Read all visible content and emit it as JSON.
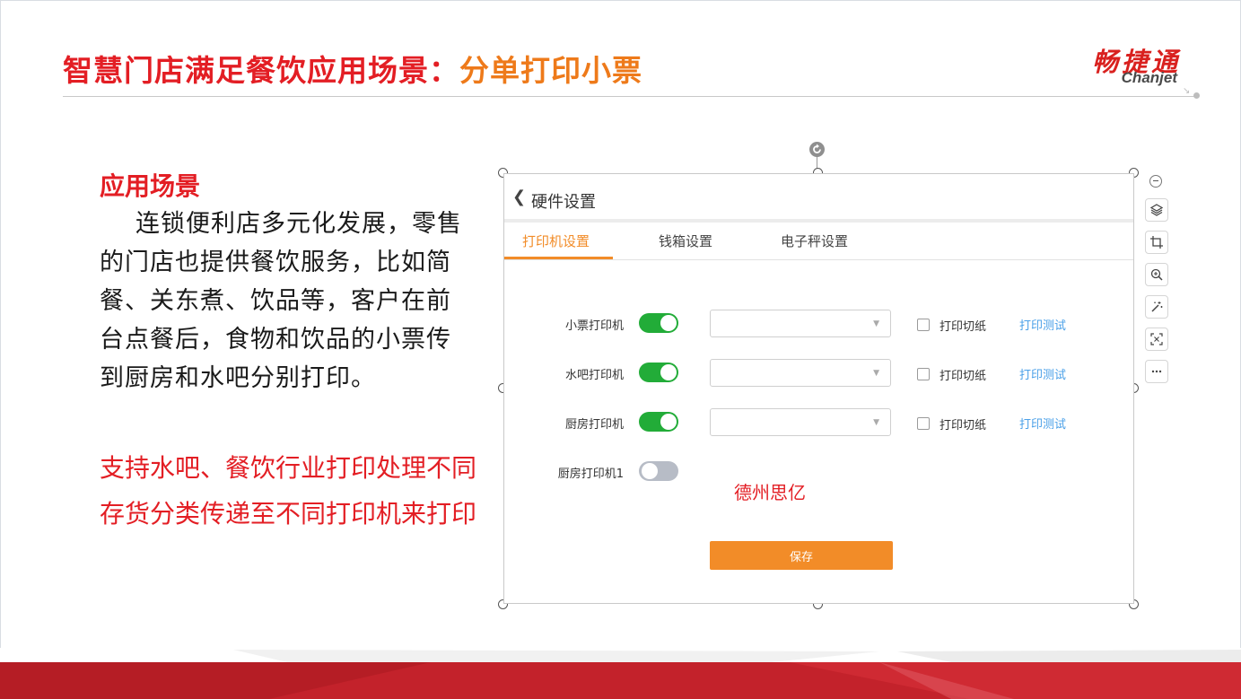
{
  "slide": {
    "title_main": "智慧门店满足餐饮应用场景：",
    "title_highlight": "分单打印小票",
    "logo_cn": "畅捷通",
    "logo_en": "Chanjet"
  },
  "scene": {
    "heading": "应用场景",
    "body": "连锁便利店多元化发展，零售的门店也提供餐饮服务，比如简餐、关东煮、饮品等，客户在前台点餐后，食物和饮品的小票传到厨房和水吧分别打印。",
    "support": "支持水吧、餐饮行业打印处理不同存货分类传递至不同打印机来打印"
  },
  "hardware": {
    "back_icon": "chevron-left-icon",
    "title": "硬件设置",
    "tabs": [
      {
        "label": "打印机设置",
        "active": true
      },
      {
        "label": "钱箱设置",
        "active": false
      },
      {
        "label": "电子秤设置",
        "active": false
      }
    ],
    "printers": [
      {
        "label": "小票打印机",
        "enabled": true,
        "selected": "",
        "cut_label": "打印切纸",
        "test_label": "打印测试"
      },
      {
        "label": "水吧打印机",
        "enabled": true,
        "selected": "",
        "cut_label": "打印切纸",
        "test_label": "打印测试"
      },
      {
        "label": "厨房打印机",
        "enabled": true,
        "selected": "",
        "cut_label": "打印切纸",
        "test_label": "打印测试"
      },
      {
        "label": "厨房打印机1",
        "enabled": false
      }
    ],
    "watermark": "德州思亿",
    "save_label": "保存"
  },
  "toolbar": {
    "icons": [
      "minus-icon",
      "layers-icon",
      "crop-icon",
      "zoom-in-icon",
      "magic-wand-icon",
      "fit-screen-icon",
      "more-icon"
    ]
  },
  "colors": {
    "brand_red": "#e31e24",
    "accent_orange": "#f28c28",
    "toggle_on": "#22ac38",
    "toggle_off": "#b7bcc6",
    "link_blue": "#4aa0e8"
  }
}
